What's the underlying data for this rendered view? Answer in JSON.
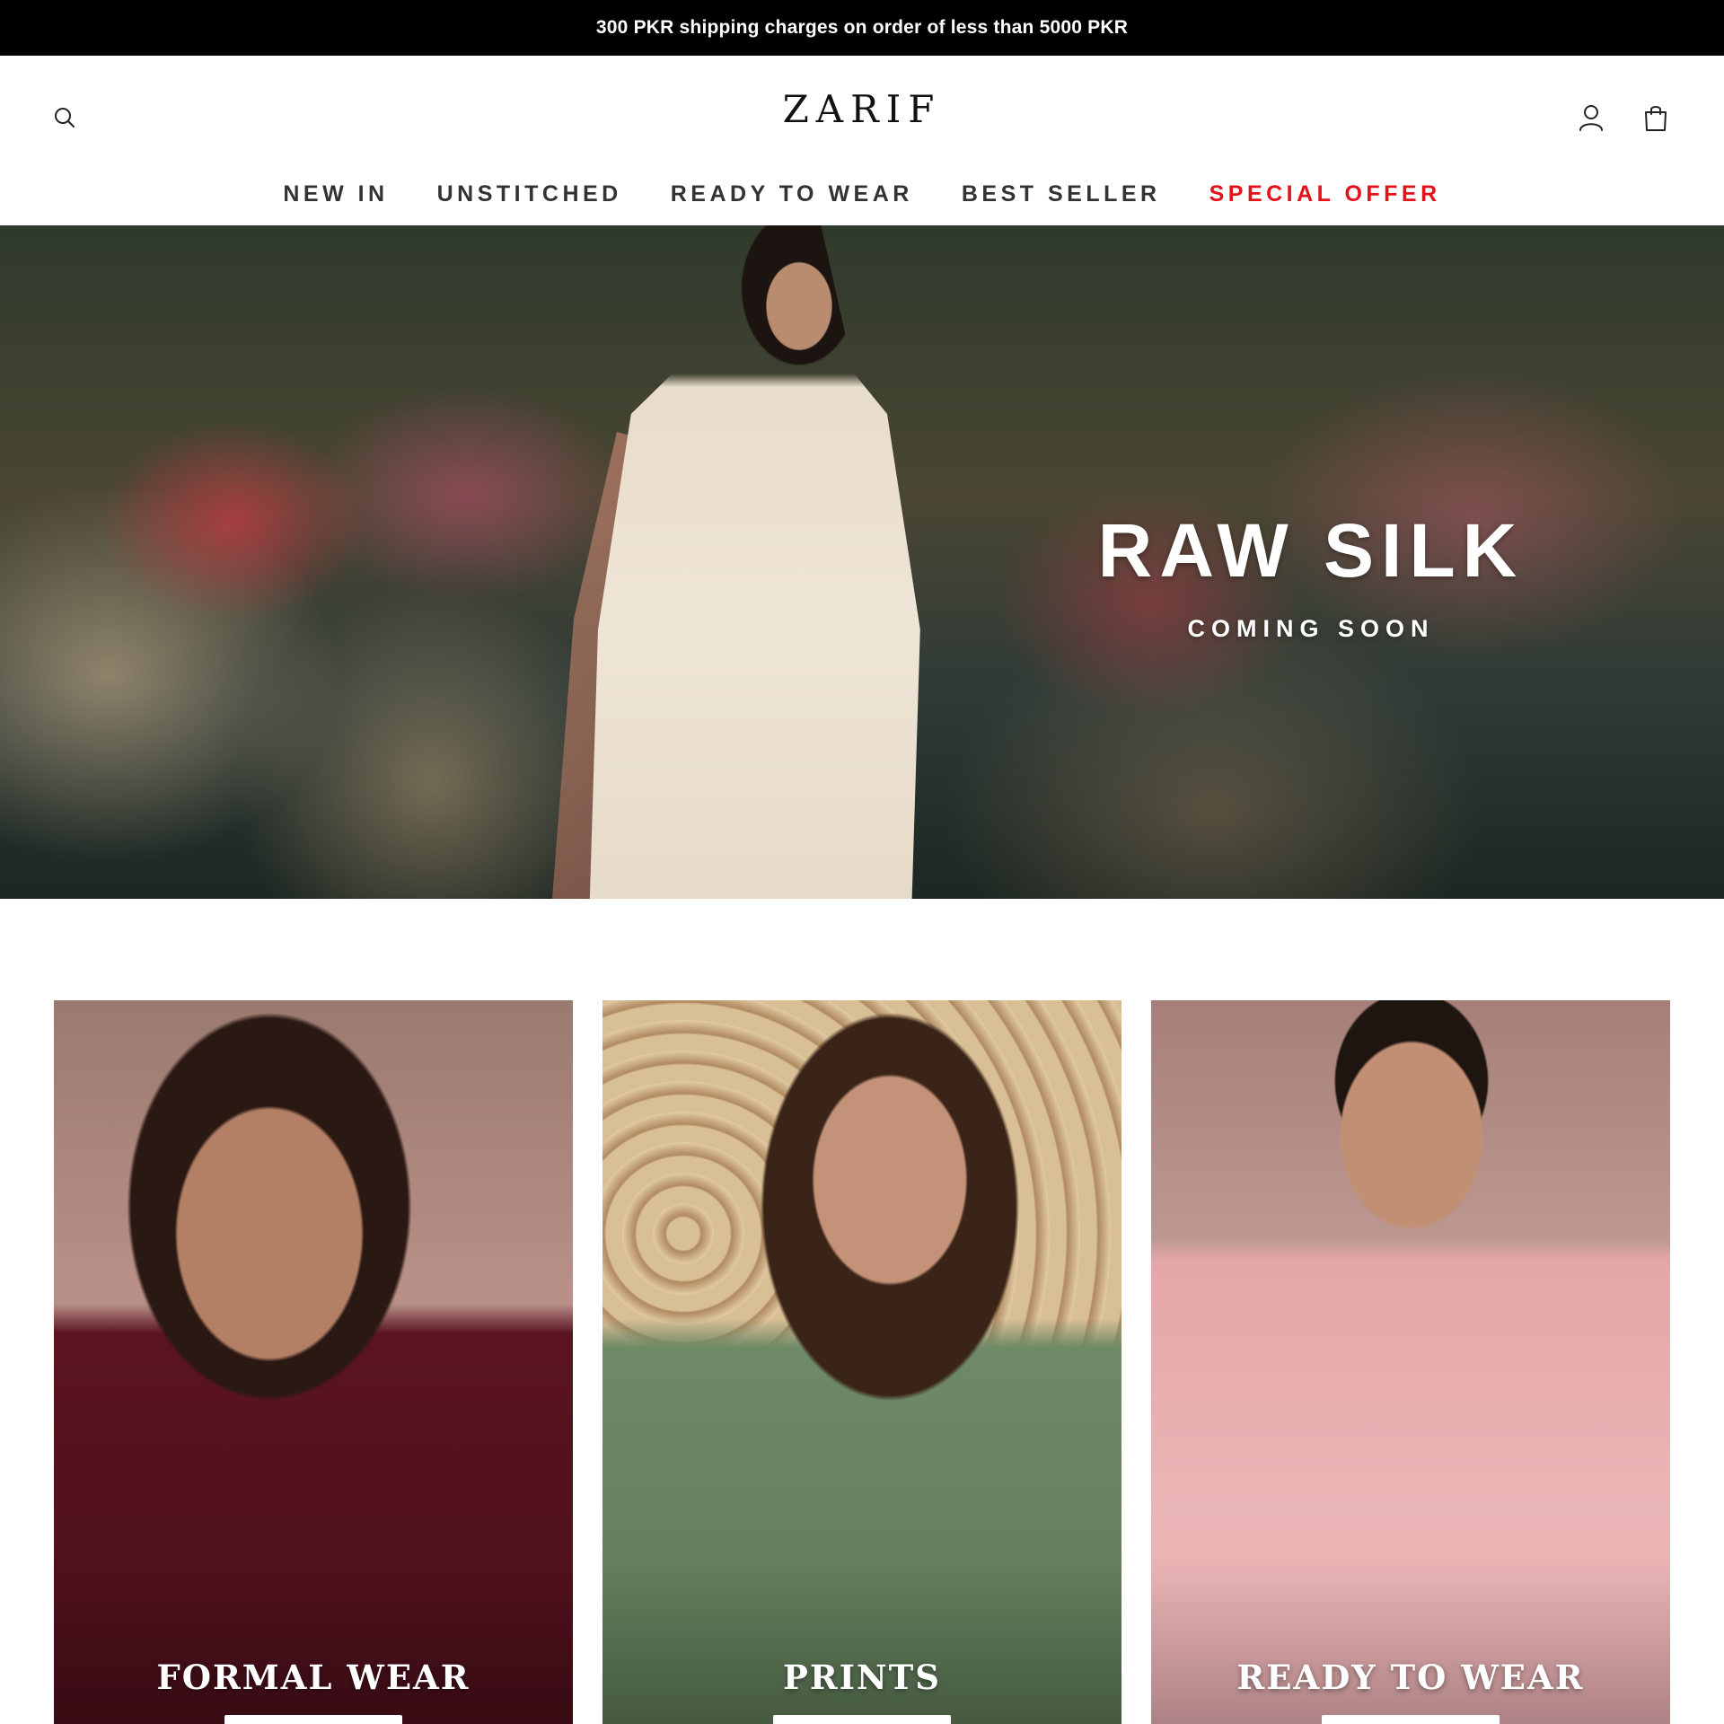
{
  "announcement": {
    "text": "300 PKR shipping charges on order of less than 5000 PKR"
  },
  "header": {
    "logo": "ZARIF",
    "icons": {
      "search": "search-icon",
      "account": "user-icon",
      "cart": "shopping-bag-icon"
    }
  },
  "nav": {
    "items": [
      {
        "label": "NEW IN"
      },
      {
        "label": "UNSTITCHED"
      },
      {
        "label": "READY TO WEAR"
      },
      {
        "label": "BEST SELLER"
      },
      {
        "label": "SPECIAL OFFER"
      }
    ],
    "special_color": "#e3121b"
  },
  "hero": {
    "title": "RAW SILK",
    "subtitle": "COMING SOON"
  },
  "collections": [
    {
      "label": "FORMAL WEAR"
    },
    {
      "label": "PRINTS"
    },
    {
      "label": "READY TO WEAR"
    }
  ],
  "colors": {
    "announcement_bg": "#000000",
    "accent": "#e3121b"
  }
}
